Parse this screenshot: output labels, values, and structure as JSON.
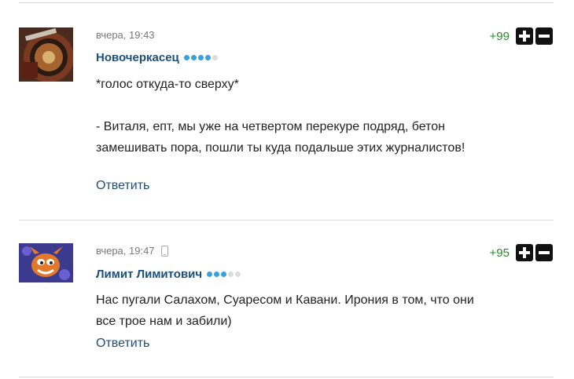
{
  "comments": [
    {
      "time": "вчера, 19:43",
      "author": "Новочеркасец",
      "rating_filled": 4,
      "rating_total": 5,
      "score": "+99",
      "text": "*голос откуда-то сверху*\n\n- Виталя, епт, мы уже на четвертом перекуре подряд, бетон\nзамешивать пора, пошли ты куда подальше этих журналистов!",
      "reply_label": "Ответить",
      "avatar_icon": "roulette-avatar"
    },
    {
      "time": "вчера, 19:47",
      "device_icon": "mobile-phone-icon",
      "author": "Лимит Лимитович",
      "rating_filled": 3,
      "rating_total": 5,
      "score": "+95",
      "text": "Нас пугали Салахом, Суаресом и Кавани. Ирония в том, что они\nвсе трое нам и забили)",
      "reply_label": "Ответить",
      "avatar_icon": "crash-bandicoot-avatar"
    }
  ],
  "colors": {
    "link": "#1b4f7c",
    "score_positive": "#2a8a2a",
    "rating_on": "#3aa0dc",
    "rating_off": "#dcdcdc"
  }
}
